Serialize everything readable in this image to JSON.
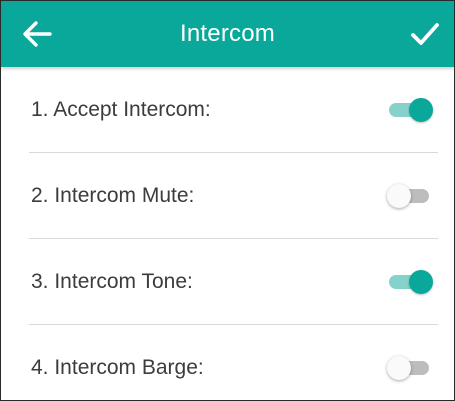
{
  "header": {
    "title": "Intercom",
    "back_icon": "arrow-left-icon",
    "confirm_icon": "check-icon"
  },
  "colors": {
    "accent": "#0aa89a",
    "accent_light": "#86d2ca",
    "text": "#3c3c3c",
    "toggle_off_track": "#bdbdbd"
  },
  "settings": [
    {
      "label": "1. Accept Intercom:",
      "enabled": true
    },
    {
      "label": "2. Intercom Mute:",
      "enabled": false
    },
    {
      "label": "3. Intercom Tone:",
      "enabled": true
    },
    {
      "label": "4. Intercom Barge:",
      "enabled": false
    }
  ]
}
